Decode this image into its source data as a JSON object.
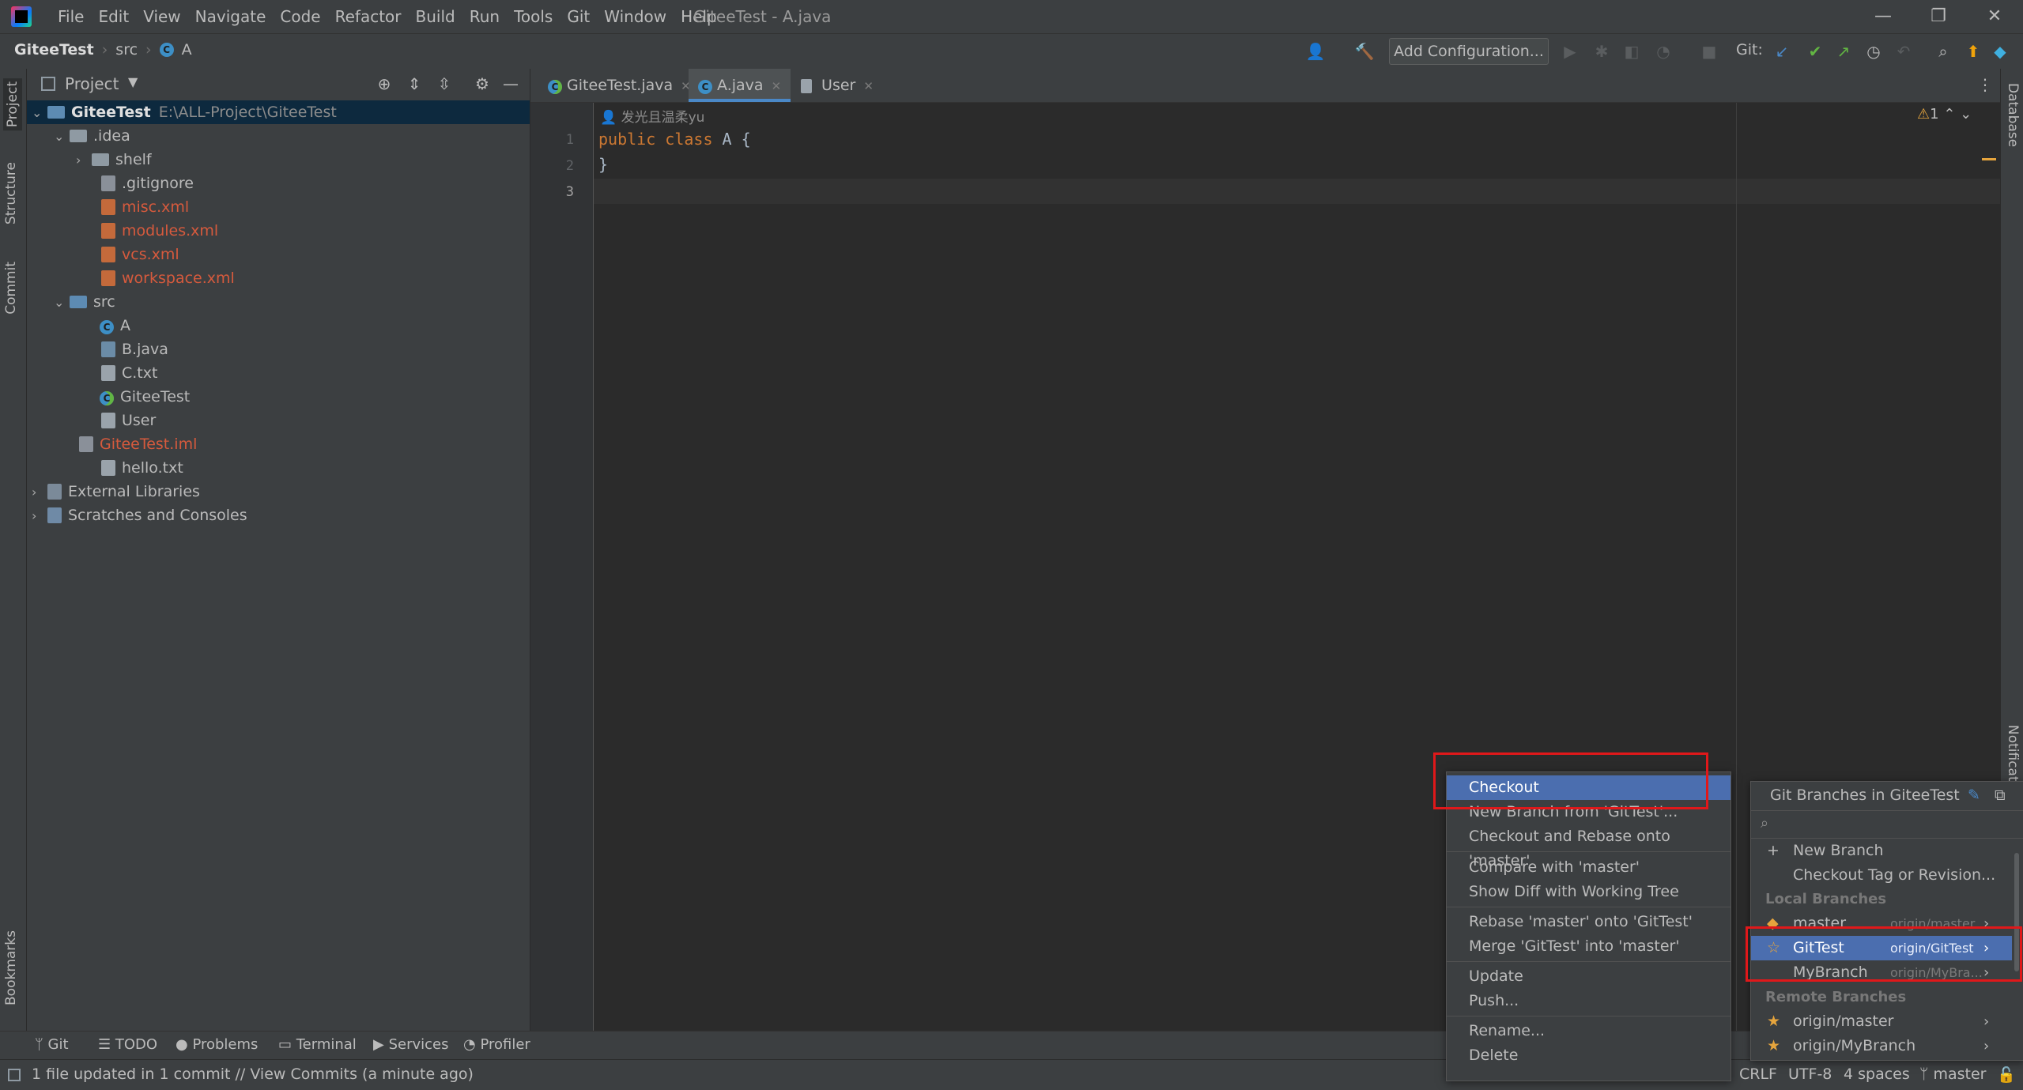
{
  "menubar": {
    "items": [
      "File",
      "Edit",
      "View",
      "Navigate",
      "Code",
      "Refactor",
      "Build",
      "Run",
      "Tools",
      "Git",
      "Window",
      "Help"
    ],
    "window_title": "GiteeTest - A.java",
    "controls": [
      "—",
      "❐",
      "✕"
    ]
  },
  "navbar": {
    "breadcrumbs": [
      "GiteeTest",
      "src",
      "A"
    ],
    "add_configuration": "Add Configuration...",
    "git_label": "Git:"
  },
  "left_strip": {
    "tabs": [
      "Project",
      "Structure",
      "Commit",
      "Bookmarks"
    ]
  },
  "right_strip": {
    "tabs": [
      "Database",
      "Notifications"
    ]
  },
  "project_panel": {
    "title": "Project",
    "tree": [
      {
        "label": "GiteeTest",
        "path": "E:\\ALL-Project\\GiteeTest"
      },
      {
        "label": ".idea"
      },
      {
        "label": "shelf"
      },
      {
        "label": ".gitignore"
      },
      {
        "label": "misc.xml"
      },
      {
        "label": "modules.xml"
      },
      {
        "label": "vcs.xml"
      },
      {
        "label": "workspace.xml"
      },
      {
        "label": "src"
      },
      {
        "label": "A"
      },
      {
        "label": "B.java"
      },
      {
        "label": "C.txt"
      },
      {
        "label": "GiteeTest"
      },
      {
        "label": "User"
      },
      {
        "label": "GiteeTest.iml"
      },
      {
        "label": "hello.txt"
      },
      {
        "label": "External Libraries"
      },
      {
        "label": "Scratches and Consoles"
      }
    ]
  },
  "editor_tabs": [
    {
      "label": "GiteeTest.java"
    },
    {
      "label": "A.java"
    },
    {
      "label": "User"
    }
  ],
  "editor": {
    "author": "发光且温柔yu",
    "line_numbers": [
      "1",
      "2",
      "3"
    ],
    "line1_kw1": "public",
    "line1_kw2": "class",
    "line1_rest": " A {",
    "line2": "}",
    "warnings_count": "1"
  },
  "context_menu": {
    "items": [
      "Checkout",
      "New Branch from 'GitTest'...",
      "Checkout and Rebase onto 'master'",
      "Compare with 'master'",
      "Show Diff with Working Tree",
      "Rebase 'master' onto 'GitTest'",
      "Merge 'GitTest' into 'master'",
      "Update",
      "Push...",
      "Rename...",
      "Delete"
    ]
  },
  "branches_popup": {
    "title": "Git Branches in GiteeTest",
    "actions": [
      "New Branch",
      "Checkout Tag or Revision..."
    ],
    "local_header": "Local Branches",
    "local": [
      {
        "name": "master",
        "tracking": "origin/master"
      },
      {
        "name": "GitTest",
        "tracking": "origin/GitTest"
      },
      {
        "name": "MyBranch",
        "tracking": "origin/MyBra..."
      }
    ],
    "remote_header": "Remote Branches",
    "remote": [
      {
        "name": "origin/master"
      },
      {
        "name": "origin/MyBranch"
      }
    ]
  },
  "bottom_tools": [
    "Git",
    "TODO",
    "Problems",
    "Terminal",
    "Services",
    "Profiler"
  ],
  "status": {
    "message": "1 file updated in 1 commit // View Commits (a minute ago)",
    "line_sep": "CRLF",
    "encoding": "UTF-8",
    "indent": "4 spaces",
    "branch": "master"
  },
  "colors": {
    "accent": "#4b6eaf",
    "highlight": "#e0181a",
    "modified_file": "#d65a3d",
    "keyword": "#cc7832"
  }
}
